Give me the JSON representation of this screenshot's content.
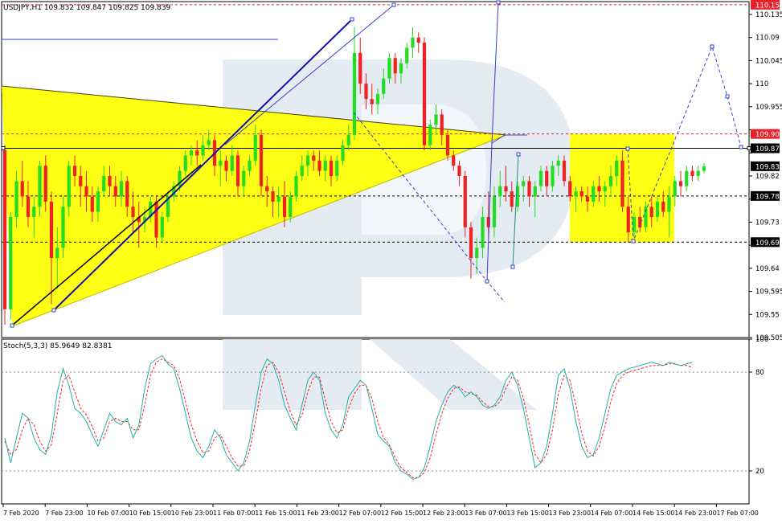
{
  "chart_data": [
    {
      "type": "candlestick",
      "header": "USDJPY,H1  109.832 109.847 109.825 109.839",
      "ylim": [
        109.505,
        110.16
      ],
      "y_ticks": [
        110.135,
        110.09,
        110.045,
        110.0,
        109.955,
        109.91,
        109.865,
        109.82,
        109.775,
        109.73,
        109.685,
        109.64,
        109.595,
        109.55,
        109.505
      ],
      "x_ticks": [
        "7 Feb 2020",
        "7 Feb 23:00",
        "10 Feb 07:00",
        "10 Feb 15:00",
        "10 Feb 23:00",
        "11 Feb 07:00",
        "11 Feb 15:00",
        "11 Feb 23:00",
        "12 Feb 07:00",
        "12 Feb 15:00",
        "12 Feb 23:00",
        "13 Feb 07:00",
        "13 Feb 15:00",
        "13 Feb 23:00",
        "14 Feb 07:00",
        "14 Feb 15:00",
        "14 Feb 23:00",
        "17 Feb 07:00"
      ],
      "price_labels": [
        {
          "value": 110.154,
          "text": "110.154",
          "color": "#e8212b"
        },
        {
          "value": 109.902,
          "text": "109.902",
          "color": "#e8212b"
        },
        {
          "value": 109.874,
          "text": "109.874",
          "color": "#000000"
        },
        {
          "value": 109.839,
          "text": "109.839",
          "color": "#000000"
        },
        {
          "value": 109.781,
          "text": "109.781",
          "color": "#000000"
        },
        {
          "value": 109.691,
          "text": "109.691",
          "color": "#000000"
        }
      ],
      "colors": {
        "bull": "#22dd22",
        "bear": "#ee2222",
        "wedge": "#ffff00",
        "watermark": "#dfe6f0",
        "projection": "#3344cc",
        "trend": "#1010aa"
      },
      "candles": [
        [
          109.87,
          109.88,
          109.53,
          109.56
        ],
        [
          109.56,
          109.75,
          109.54,
          109.74
        ],
        [
          109.74,
          109.83,
          109.72,
          109.81
        ],
        [
          109.81,
          109.85,
          109.76,
          109.78
        ],
        [
          109.78,
          109.81,
          109.72,
          109.74
        ],
        [
          109.74,
          109.78,
          109.7,
          109.76
        ],
        [
          109.76,
          109.85,
          109.74,
          109.84
        ],
        [
          109.84,
          109.86,
          109.75,
          109.77
        ],
        [
          109.77,
          109.79,
          109.57,
          109.66
        ],
        [
          109.66,
          109.72,
          109.6,
          109.68
        ],
        [
          109.68,
          109.78,
          109.66,
          109.76
        ],
        [
          109.76,
          109.85,
          109.74,
          109.84
        ],
        [
          109.84,
          109.86,
          109.8,
          109.82
        ],
        [
          109.82,
          109.84,
          109.76,
          109.8
        ],
        [
          109.8,
          109.83,
          109.75,
          109.78
        ],
        [
          109.78,
          109.8,
          109.73,
          109.75
        ],
        [
          109.75,
          109.8,
          109.73,
          109.79
        ],
        [
          109.79,
          109.84,
          109.78,
          109.82
        ],
        [
          109.82,
          109.84,
          109.78,
          109.8
        ],
        [
          109.8,
          109.82,
          109.76,
          109.78
        ],
        [
          109.78,
          109.83,
          109.76,
          109.81
        ],
        [
          109.81,
          109.82,
          109.74,
          109.76
        ],
        [
          109.76,
          109.79,
          109.71,
          109.74
        ],
        [
          109.74,
          109.77,
          109.68,
          109.73
        ],
        [
          109.73,
          109.76,
          109.71,
          109.74
        ],
        [
          109.74,
          109.78,
          109.73,
          109.77
        ],
        [
          109.77,
          109.78,
          109.68,
          109.7
        ],
        [
          109.7,
          109.75,
          109.69,
          109.74
        ],
        [
          109.74,
          109.79,
          109.73,
          109.78
        ],
        [
          109.78,
          109.81,
          109.77,
          109.8
        ],
        [
          109.8,
          109.84,
          109.79,
          109.83
        ],
        [
          109.83,
          109.87,
          109.82,
          109.86
        ],
        [
          109.86,
          109.88,
          109.84,
          109.87
        ],
        [
          109.87,
          109.89,
          109.84,
          109.86
        ],
        [
          109.86,
          109.9,
          109.85,
          109.88
        ],
        [
          109.88,
          109.91,
          109.87,
          109.89
        ],
        [
          109.89,
          109.9,
          109.82,
          109.84
        ],
        [
          109.84,
          109.87,
          109.8,
          109.85
        ],
        [
          109.85,
          109.86,
          109.81,
          109.83
        ],
        [
          109.83,
          109.88,
          109.82,
          109.86
        ],
        [
          109.86,
          109.87,
          109.78,
          109.8
        ],
        [
          109.8,
          109.84,
          109.78,
          109.83
        ],
        [
          109.83,
          109.86,
          109.82,
          109.85
        ],
        [
          109.85,
          109.92,
          109.84,
          109.9
        ],
        [
          109.9,
          109.91,
          109.78,
          109.8
        ],
        [
          109.8,
          109.82,
          109.76,
          109.79
        ],
        [
          109.79,
          109.8,
          109.74,
          109.77
        ],
        [
          109.77,
          109.8,
          109.74,
          109.78
        ],
        [
          109.78,
          109.81,
          109.72,
          109.74
        ],
        [
          109.74,
          109.79,
          109.73,
          109.78
        ],
        [
          109.78,
          109.83,
          109.77,
          109.82
        ],
        [
          109.82,
          109.86,
          109.81,
          109.84
        ],
        [
          109.84,
          109.87,
          109.82,
          109.86
        ],
        [
          109.86,
          109.87,
          109.83,
          109.85
        ],
        [
          109.85,
          109.87,
          109.82,
          109.83
        ],
        [
          109.83,
          109.86,
          109.81,
          109.85
        ],
        [
          109.85,
          109.86,
          109.8,
          109.82
        ],
        [
          109.82,
          109.86,
          109.81,
          109.85
        ],
        [
          109.85,
          109.89,
          109.84,
          109.88
        ],
        [
          109.88,
          109.92,
          109.87,
          109.9
        ],
        [
          109.9,
          110.11,
          109.89,
          110.06
        ],
        [
          110.06,
          110.09,
          109.98,
          110.0
        ],
        [
          110.0,
          110.02,
          109.95,
          109.97
        ],
        [
          109.97,
          110.0,
          109.94,
          109.96
        ],
        [
          109.96,
          109.99,
          109.94,
          109.98
        ],
        [
          109.98,
          110.03,
          109.97,
          110.01
        ],
        [
          110.01,
          110.06,
          110.0,
          110.05
        ],
        [
          110.05,
          110.06,
          110.0,
          110.02
        ],
        [
          110.02,
          110.05,
          110.0,
          110.04
        ],
        [
          110.04,
          110.08,
          110.03,
          110.07
        ],
        [
          110.07,
          110.11,
          110.05,
          110.09
        ],
        [
          110.09,
          110.1,
          110.06,
          110.08
        ],
        [
          110.08,
          110.09,
          109.87,
          109.88
        ],
        [
          109.88,
          109.93,
          109.87,
          109.92
        ],
        [
          109.92,
          109.96,
          109.9,
          109.94
        ],
        [
          109.94,
          109.95,
          109.88,
          109.9
        ],
        [
          109.9,
          109.91,
          109.85,
          109.86
        ],
        [
          109.86,
          109.87,
          109.83,
          109.84
        ],
        [
          109.84,
          109.85,
          109.8,
          109.82
        ],
        [
          109.82,
          109.83,
          109.7,
          109.72
        ],
        [
          109.72,
          109.73,
          109.62,
          109.66
        ],
        [
          109.66,
          109.7,
          109.63,
          109.68
        ],
        [
          109.68,
          109.76,
          109.66,
          109.74
        ],
        [
          109.74,
          109.79,
          109.7,
          109.72
        ],
        [
          109.72,
          109.8,
          109.7,
          109.78
        ],
        [
          109.78,
          109.83,
          109.76,
          109.8
        ],
        [
          109.8,
          109.84,
          109.77,
          109.79
        ],
        [
          109.79,
          109.81,
          109.75,
          109.76
        ],
        [
          109.76,
          109.81,
          109.75,
          109.8
        ],
        [
          109.8,
          109.82,
          109.77,
          109.81
        ],
        [
          109.81,
          109.82,
          109.76,
          109.78
        ],
        [
          109.78,
          109.81,
          109.74,
          109.8
        ],
        [
          109.8,
          109.84,
          109.79,
          109.83
        ],
        [
          109.83,
          109.84,
          109.78,
          109.8
        ],
        [
          109.8,
          109.85,
          109.79,
          109.84
        ],
        [
          109.84,
          109.86,
          109.82,
          109.85
        ],
        [
          109.85,
          109.86,
          109.8,
          109.81
        ],
        [
          109.81,
          109.82,
          109.77,
          109.78
        ],
        [
          109.78,
          109.8,
          109.75,
          109.79
        ],
        [
          109.79,
          109.8,
          109.77,
          109.78
        ],
        [
          109.78,
          109.8,
          109.75,
          109.77
        ],
        [
          109.77,
          109.81,
          109.76,
          109.8
        ],
        [
          109.8,
          109.82,
          109.77,
          109.79
        ],
        [
          109.79,
          109.81,
          109.76,
          109.8
        ],
        [
          109.8,
          109.84,
          109.78,
          109.82
        ],
        [
          109.82,
          109.86,
          109.8,
          109.85
        ],
        [
          109.85,
          109.87,
          109.75,
          109.76
        ],
        [
          109.76,
          109.78,
          109.69,
          109.71
        ],
        [
          109.71,
          109.75,
          109.7,
          109.74
        ],
        [
          109.74,
          109.76,
          109.71,
          109.72
        ],
        [
          109.72,
          109.77,
          109.71,
          109.76
        ],
        [
          109.76,
          109.78,
          109.72,
          109.74
        ],
        [
          109.74,
          109.78,
          109.73,
          109.77
        ],
        [
          109.77,
          109.79,
          109.74,
          109.75
        ],
        [
          109.75,
          109.8,
          109.7,
          109.78
        ],
        [
          109.78,
          109.82,
          109.76,
          109.81
        ],
        [
          109.81,
          109.83,
          109.78,
          109.8
        ],
        [
          109.8,
          109.84,
          109.79,
          109.83
        ],
        [
          109.83,
          109.84,
          109.81,
          109.82
        ],
        [
          109.82,
          109.84,
          109.81,
          109.83
        ],
        [
          109.83,
          109.845,
          109.825,
          109.839
        ]
      ]
    },
    {
      "type": "line",
      "header": "Stoch(5,3,3) 85.9649 82.8381",
      "ylim": [
        0,
        100
      ],
      "y_ticks": [
        100,
        80,
        20
      ],
      "levels": [
        80,
        20
      ],
      "colors": {
        "main": "#20b2aa",
        "signal": "#ff2020"
      },
      "series": [
        {
          "values": [
            40,
            25,
            40,
            55,
            52,
            40,
            33,
            30,
            42,
            68,
            82,
            72,
            58,
            55,
            50,
            42,
            35,
            45,
            55,
            50,
            48,
            52,
            40,
            48,
            70,
            85,
            88,
            90,
            85,
            82,
            70,
            55,
            40,
            32,
            28,
            35,
            45,
            40,
            30,
            25,
            20,
            25,
            38,
            60,
            80,
            88,
            85,
            75,
            60,
            52,
            45,
            60,
            75,
            80,
            75,
            55,
            45,
            40,
            48,
            65,
            70,
            75,
            72,
            58,
            42,
            38,
            35,
            25,
            20,
            18,
            15,
            16,
            22,
            35,
            50,
            60,
            68,
            72,
            70,
            65,
            68,
            65,
            60,
            58,
            60,
            65,
            75,
            80,
            72,
            58,
            40,
            22,
            25,
            35,
            55,
            78,
            82,
            70,
            50,
            35,
            28,
            30,
            40,
            55,
            70,
            78,
            80,
            82,
            83,
            84,
            85,
            86,
            85,
            84,
            86,
            85,
            84,
            85,
            85.96
          ]
        },
        {
          "values": [
            38,
            30,
            33,
            45,
            52,
            48,
            38,
            32,
            36,
            55,
            75,
            78,
            68,
            58,
            54,
            47,
            38,
            40,
            50,
            52,
            50,
            50,
            45,
            45,
            60,
            78,
            86,
            88,
            86,
            84,
            76,
            62,
            48,
            38,
            31,
            32,
            40,
            42,
            35,
            28,
            23,
            23,
            32,
            50,
            70,
            84,
            86,
            80,
            68,
            56,
            48,
            54,
            68,
            77,
            77,
            63,
            50,
            43,
            45,
            58,
            67,
            72,
            72,
            64,
            50,
            40,
            36,
            28,
            22,
            19,
            16,
            16,
            19,
            28,
            42,
            55,
            64,
            70,
            71,
            68,
            67,
            66,
            62,
            59,
            59,
            62,
            70,
            77,
            75,
            64,
            48,
            30,
            25,
            30,
            45,
            67,
            78,
            75,
            60,
            43,
            32,
            29,
            35,
            47,
            62,
            73,
            78,
            80,
            81,
            82,
            83,
            84,
            84,
            84,
            85,
            85,
            84,
            84,
            82.84
          ]
        }
      ]
    }
  ]
}
